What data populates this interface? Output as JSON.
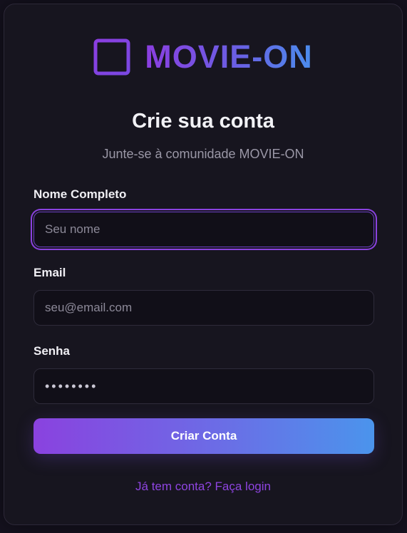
{
  "brand": {
    "name": "MOVIE-ON",
    "icon": "film-icon",
    "gradient": [
      "#8b3ee0",
      "#4b8ded"
    ]
  },
  "heading": {
    "title": "Crie sua conta",
    "subtitle": "Junte-se à comunidade MOVIE-ON"
  },
  "form": {
    "name_label": "Nome Completo",
    "name_placeholder": "Seu nome",
    "email_label": "Email",
    "email_placeholder": "seu@email.com",
    "password_label": "Senha",
    "password_placeholder": "••••••••",
    "submit_label": "Criar Conta"
  },
  "footer": {
    "login_link": "Já tem conta? Faça login"
  },
  "colors": {
    "background": "#15121f",
    "card": "#17151f",
    "accent": "#8a42df",
    "link": "#8e44e0"
  }
}
